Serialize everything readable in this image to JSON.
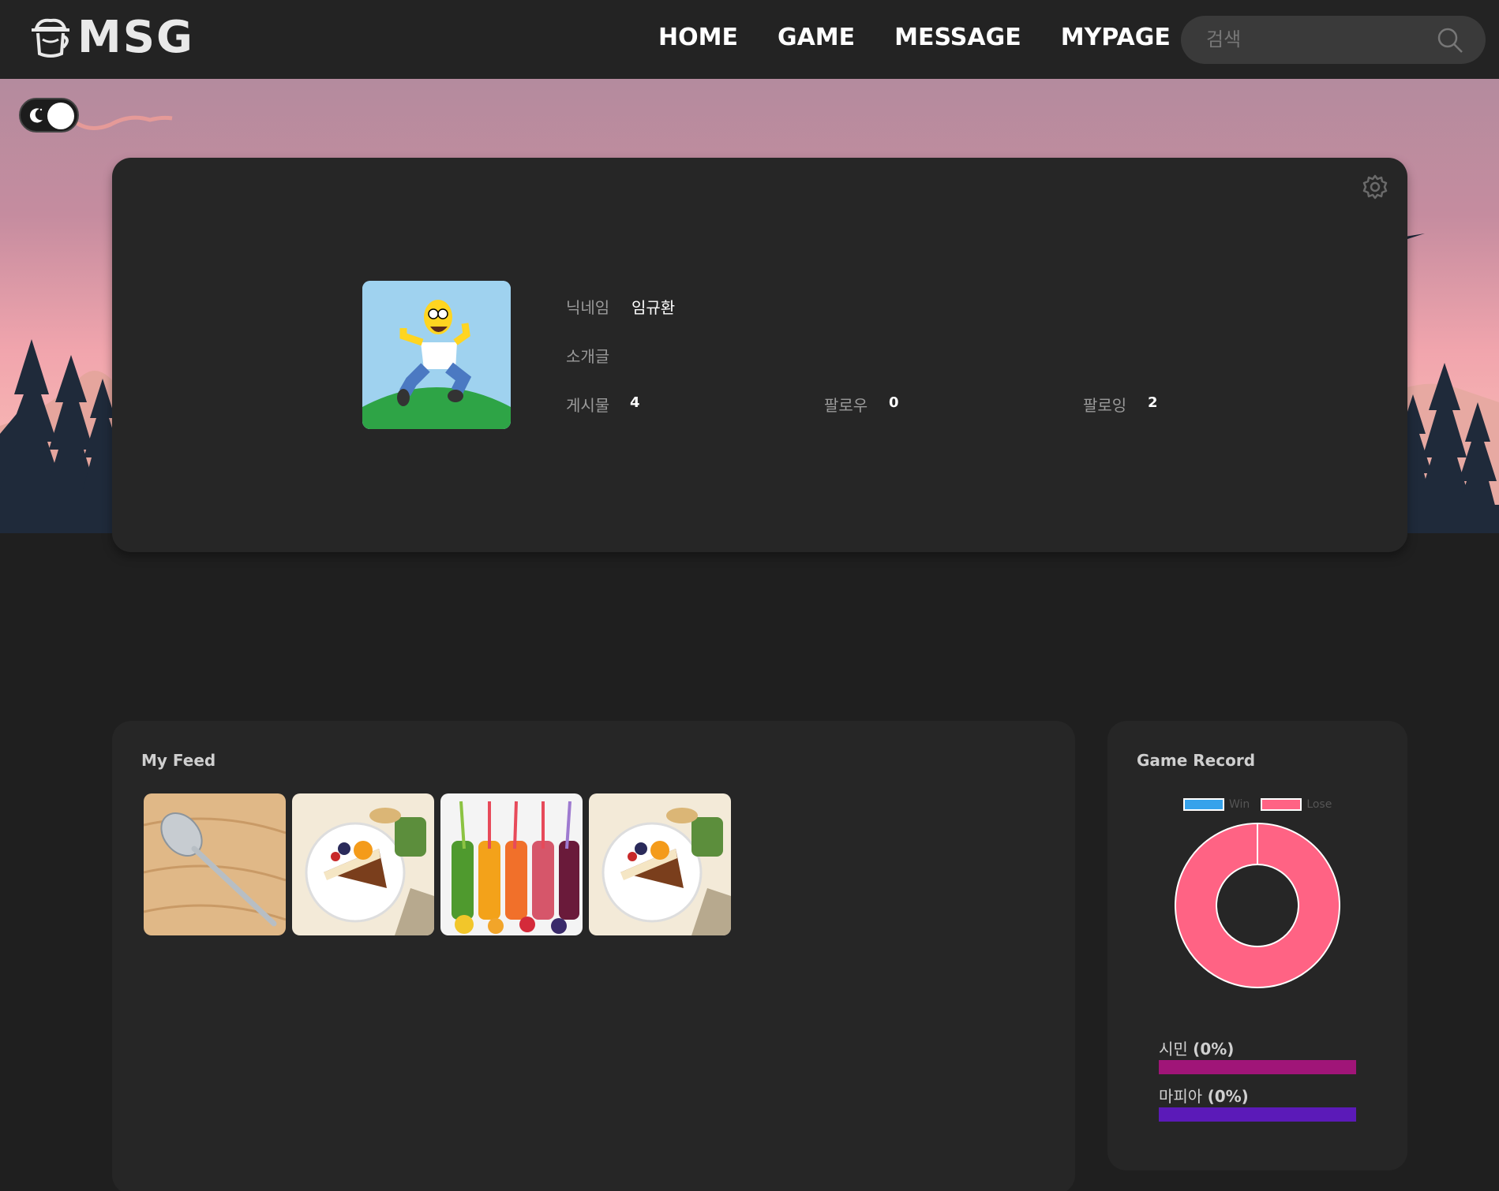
{
  "nav": {
    "brand": "MSG",
    "links": [
      "HOME",
      "GAME",
      "MESSAGE",
      "MYPAGE"
    ],
    "search_placeholder": "검색"
  },
  "profile": {
    "nickname_label": "닉네임",
    "nickname": "임규환",
    "bio_label": "소개글",
    "bio": "",
    "posts_label": "게시물",
    "posts": "4",
    "followers_label": "팔로우",
    "followers": "0",
    "following_label": "팔로잉",
    "following": "2"
  },
  "feed": {
    "title": "My Feed",
    "items": [
      "spoon",
      "dessert-plate",
      "smoothie-bottles",
      "dessert-plate"
    ]
  },
  "game_record": {
    "title": "Game Record",
    "stats": [
      {
        "name": "시민",
        "pct_text": "(0%)",
        "value": 0,
        "color": "#a01578"
      },
      {
        "name": "마피아",
        "pct_text": "(0%)",
        "value": 0,
        "color": "#5b1ab8"
      }
    ]
  },
  "chart_data": {
    "type": "pie",
    "subtype": "doughnut",
    "labels": [
      "Win",
      "Lose"
    ],
    "values": [
      0,
      1
    ],
    "colors": [
      "#36a2eb",
      "#ff6384"
    ],
    "legend": "top"
  }
}
